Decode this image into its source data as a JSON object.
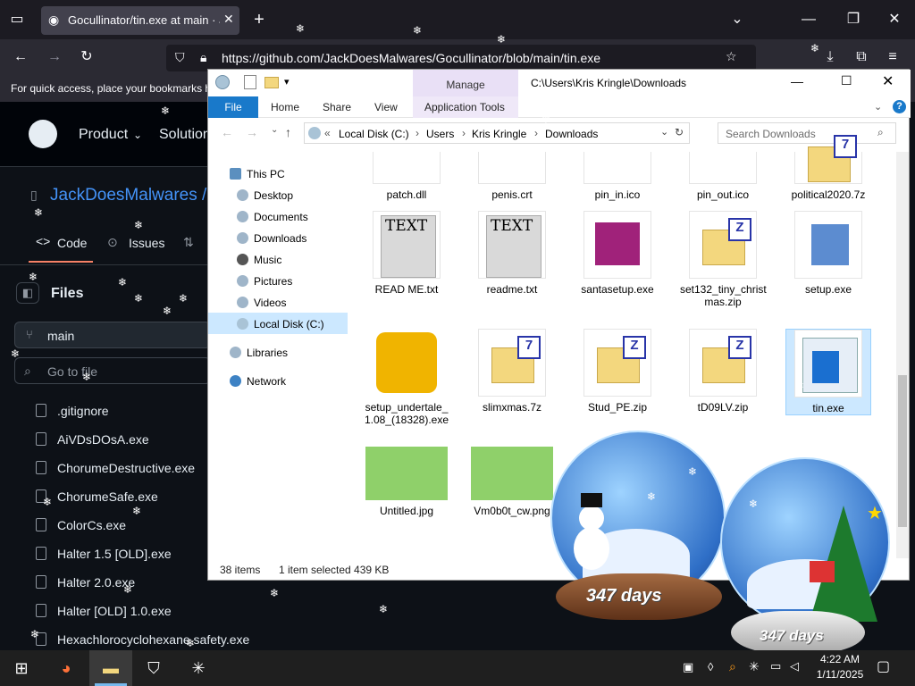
{
  "browser": {
    "tab_title": "Gocullinator/tin.exe at main · Ja",
    "url": "https://github.com/JackDoesMalwares/Gocullinator/blob/main/tin.exe",
    "bookmarks_hint": "For quick access, place your bookmarks h"
  },
  "github": {
    "nav": [
      "Product",
      "Solution"
    ],
    "repo_owner": "JackDoesMalwares /",
    "tabs": [
      "Code",
      "Issues"
    ],
    "files_heading": "Files",
    "branch": "main",
    "goto_placeholder": "Go to file",
    "files": [
      ".gitignore",
      "AiVDsDOsA.exe",
      "ChorumeDestructive.exe",
      "ChorumeSafe.exe",
      "ColorCs.exe",
      "Halter 1.5 [OLD].exe",
      "Halter 2.0.exe",
      "Halter [OLD] 1.0.exe",
      "Hexachlorocyclohexane safety.exe"
    ]
  },
  "explorer": {
    "manage_label": "Manage",
    "path_title": "C:\\Users\\Kris Kringle\\Downloads",
    "ribbon": {
      "file": "File",
      "home": "Home",
      "share": "Share",
      "view": "View",
      "app_tools": "Application Tools"
    },
    "address": [
      "Local Disk (C:)",
      "Users",
      "Kris Kringle",
      "Downloads"
    ],
    "search_placeholder": "Search Downloads",
    "nav": {
      "this_pc": "This PC",
      "desktop": "Desktop",
      "documents": "Documents",
      "downloads": "Downloads",
      "music": "Music",
      "pictures": "Pictures",
      "videos": "Videos",
      "local_disk": "Local Disk (C:)",
      "libraries": "Libraries",
      "network": "Network"
    },
    "items_row1": [
      "patch.dll",
      "penis.crt",
      "pin_in.ico",
      "pin_out.ico",
      "political2020.7z"
    ],
    "items_row2": [
      "READ ME.txt",
      "readme.txt",
      "santasetup.exe",
      "set132_tiny_christ mas.zip",
      "setup.exe"
    ],
    "items_row3": [
      "setup_undertale_ 1.08_(18328).exe",
      "slimxmas.7z",
      "Stud_PE.zip",
      "tD09LV.zip",
      "tin.exe"
    ],
    "items_row4": [
      "Untitled.jpg",
      "Vm0b0t_cw.png"
    ],
    "status_count": "38 items",
    "status_selected": "1 item selected 439 KB"
  },
  "globes": {
    "countdown1": "347 days",
    "countdown2": "347 days"
  },
  "taskbar": {
    "time": "4:22 AM",
    "date": "1/11/2025"
  },
  "colors": {
    "accent": "#1979ca",
    "selection": "#cce8ff",
    "github_bg": "#010409"
  }
}
